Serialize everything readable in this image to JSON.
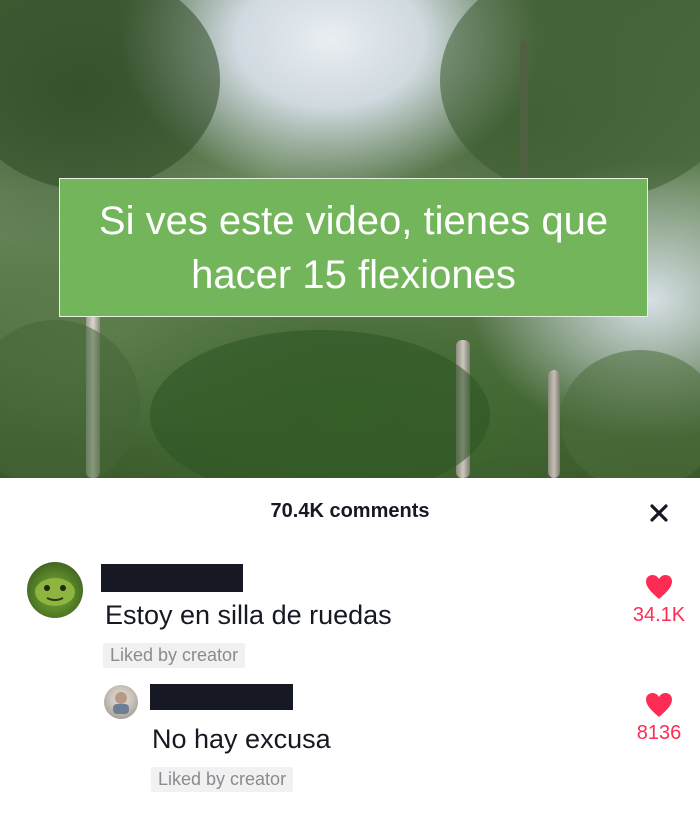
{
  "video": {
    "caption": "Si ves este video, tienes que hacer 15 flexiones"
  },
  "comments_panel": {
    "count_label": "70.4K comments",
    "close_icon": "close-icon",
    "comments": [
      {
        "text": "Estoy en silla de ruedas",
        "badge": "Liked by creator",
        "likes": "34.1K",
        "like_icon": "heart-icon"
      },
      {
        "text": "No hay excusa",
        "badge": "Liked by creator",
        "likes": "8136",
        "like_icon": "heart-icon"
      }
    ]
  },
  "colors": {
    "caption_bg": "#72b55a",
    "like_red": "#fe2c55",
    "text_dark": "#161823",
    "badge_bg": "#f1f1f2"
  }
}
